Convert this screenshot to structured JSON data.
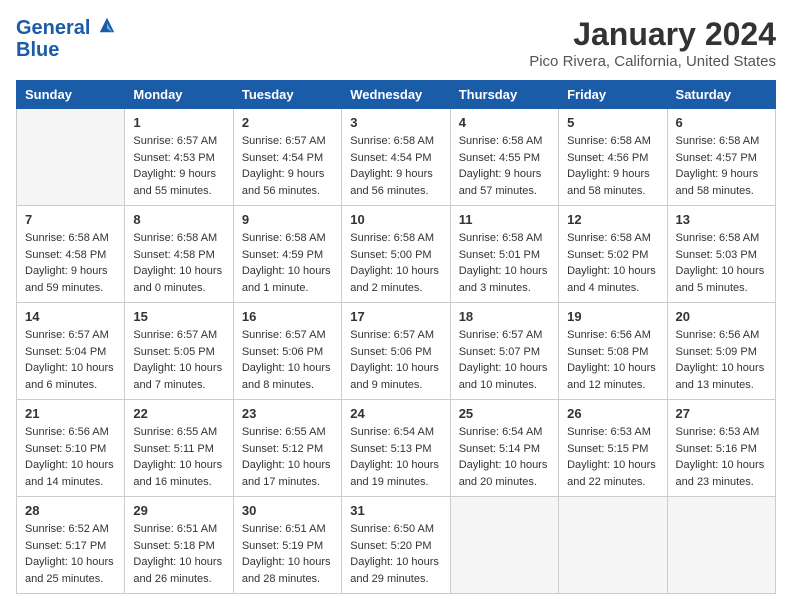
{
  "header": {
    "logo_line1": "General",
    "logo_line2": "Blue",
    "month": "January 2024",
    "location": "Pico Rivera, California, United States"
  },
  "days_of_week": [
    "Sunday",
    "Monday",
    "Tuesday",
    "Wednesday",
    "Thursday",
    "Friday",
    "Saturday"
  ],
  "weeks": [
    [
      {
        "day": "",
        "empty": true
      },
      {
        "day": "1",
        "sunrise": "6:57 AM",
        "sunset": "4:53 PM",
        "daylight": "9 hours and 55 minutes."
      },
      {
        "day": "2",
        "sunrise": "6:57 AM",
        "sunset": "4:54 PM",
        "daylight": "9 hours and 56 minutes."
      },
      {
        "day": "3",
        "sunrise": "6:58 AM",
        "sunset": "4:54 PM",
        "daylight": "9 hours and 56 minutes."
      },
      {
        "day": "4",
        "sunrise": "6:58 AM",
        "sunset": "4:55 PM",
        "daylight": "9 hours and 57 minutes."
      },
      {
        "day": "5",
        "sunrise": "6:58 AM",
        "sunset": "4:56 PM",
        "daylight": "9 hours and 58 minutes."
      },
      {
        "day": "6",
        "sunrise": "6:58 AM",
        "sunset": "4:57 PM",
        "daylight": "9 hours and 58 minutes."
      }
    ],
    [
      {
        "day": "7",
        "sunrise": "6:58 AM",
        "sunset": "4:58 PM",
        "daylight": "9 hours and 59 minutes."
      },
      {
        "day": "8",
        "sunrise": "6:58 AM",
        "sunset": "4:58 PM",
        "daylight": "10 hours and 0 minutes."
      },
      {
        "day": "9",
        "sunrise": "6:58 AM",
        "sunset": "4:59 PM",
        "daylight": "10 hours and 1 minute."
      },
      {
        "day": "10",
        "sunrise": "6:58 AM",
        "sunset": "5:00 PM",
        "daylight": "10 hours and 2 minutes."
      },
      {
        "day": "11",
        "sunrise": "6:58 AM",
        "sunset": "5:01 PM",
        "daylight": "10 hours and 3 minutes."
      },
      {
        "day": "12",
        "sunrise": "6:58 AM",
        "sunset": "5:02 PM",
        "daylight": "10 hours and 4 minutes."
      },
      {
        "day": "13",
        "sunrise": "6:58 AM",
        "sunset": "5:03 PM",
        "daylight": "10 hours and 5 minutes."
      }
    ],
    [
      {
        "day": "14",
        "sunrise": "6:57 AM",
        "sunset": "5:04 PM",
        "daylight": "10 hours and 6 minutes."
      },
      {
        "day": "15",
        "sunrise": "6:57 AM",
        "sunset": "5:05 PM",
        "daylight": "10 hours and 7 minutes."
      },
      {
        "day": "16",
        "sunrise": "6:57 AM",
        "sunset": "5:06 PM",
        "daylight": "10 hours and 8 minutes."
      },
      {
        "day": "17",
        "sunrise": "6:57 AM",
        "sunset": "5:06 PM",
        "daylight": "10 hours and 9 minutes."
      },
      {
        "day": "18",
        "sunrise": "6:57 AM",
        "sunset": "5:07 PM",
        "daylight": "10 hours and 10 minutes."
      },
      {
        "day": "19",
        "sunrise": "6:56 AM",
        "sunset": "5:08 PM",
        "daylight": "10 hours and 12 minutes."
      },
      {
        "day": "20",
        "sunrise": "6:56 AM",
        "sunset": "5:09 PM",
        "daylight": "10 hours and 13 minutes."
      }
    ],
    [
      {
        "day": "21",
        "sunrise": "6:56 AM",
        "sunset": "5:10 PM",
        "daylight": "10 hours and 14 minutes."
      },
      {
        "day": "22",
        "sunrise": "6:55 AM",
        "sunset": "5:11 PM",
        "daylight": "10 hours and 16 minutes."
      },
      {
        "day": "23",
        "sunrise": "6:55 AM",
        "sunset": "5:12 PM",
        "daylight": "10 hours and 17 minutes."
      },
      {
        "day": "24",
        "sunrise": "6:54 AM",
        "sunset": "5:13 PM",
        "daylight": "10 hours and 19 minutes."
      },
      {
        "day": "25",
        "sunrise": "6:54 AM",
        "sunset": "5:14 PM",
        "daylight": "10 hours and 20 minutes."
      },
      {
        "day": "26",
        "sunrise": "6:53 AM",
        "sunset": "5:15 PM",
        "daylight": "10 hours and 22 minutes."
      },
      {
        "day": "27",
        "sunrise": "6:53 AM",
        "sunset": "5:16 PM",
        "daylight": "10 hours and 23 minutes."
      }
    ],
    [
      {
        "day": "28",
        "sunrise": "6:52 AM",
        "sunset": "5:17 PM",
        "daylight": "10 hours and 25 minutes."
      },
      {
        "day": "29",
        "sunrise": "6:51 AM",
        "sunset": "5:18 PM",
        "daylight": "10 hours and 26 minutes."
      },
      {
        "day": "30",
        "sunrise": "6:51 AM",
        "sunset": "5:19 PM",
        "daylight": "10 hours and 28 minutes."
      },
      {
        "day": "31",
        "sunrise": "6:50 AM",
        "sunset": "5:20 PM",
        "daylight": "10 hours and 29 minutes."
      },
      {
        "day": "",
        "empty": true
      },
      {
        "day": "",
        "empty": true
      },
      {
        "day": "",
        "empty": true
      }
    ]
  ],
  "labels": {
    "sunrise_prefix": "Sunrise:",
    "sunset_prefix": "Sunset:",
    "daylight_prefix": "Daylight:"
  }
}
